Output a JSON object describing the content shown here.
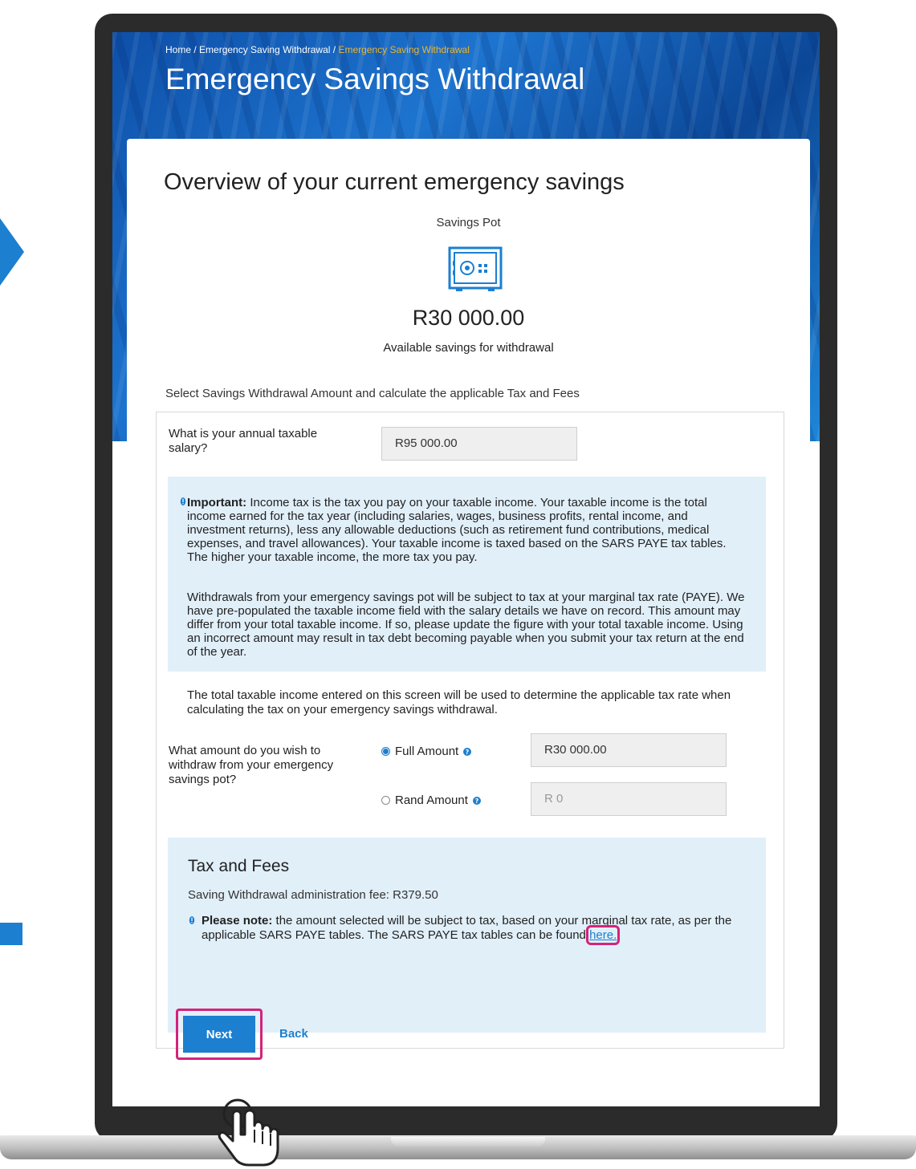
{
  "breadcrumb": {
    "home": "Home",
    "sep1": " / ",
    "section": "Emergency Saving Withdrawal",
    "sep2": " / ",
    "current": "Emergency Saving Withdrawal"
  },
  "page_title": "Emergency Savings Withdrawal",
  "overview": {
    "title": "Overview of your current emergency savings",
    "pot_label": "Savings Pot",
    "pot_icon": "safe-icon",
    "amount": "R30 000.00",
    "amount_caption": "Available savings for withdrawal",
    "select_caption": "Select Savings Withdrawal Amount and calculate the applicable Tax and Fees"
  },
  "salary": {
    "label": "What is your annual taxable salary?",
    "value": "R95 000.00"
  },
  "important": {
    "lead": "Important:",
    "para1": " Income tax is the tax you pay on your taxable income. Your taxable income is the total income earned for the tax year (including salaries, wages, business profits, rental income, and investment returns), less any allowable deductions (such as retirement fund contributions, medical expenses, and travel allowances). Your taxable income is taxed based on the SARS PAYE tax tables. The higher your taxable income, the more tax you pay.",
    "para2": "Withdrawals from your emergency savings pot will be subject to tax at your marginal tax rate (PAYE). We have pre-populated the taxable income field with the salary details we have on record. This amount may differ from your total taxable income. If so, please update the figure with your total taxable income. Using an incorrect amount may result in tax debt becoming payable when you submit your tax return at the end of the year."
  },
  "note": "The total taxable income entered on this screen will be used to determine the applicable tax rate when calculating the tax on your emergency savings withdrawal.",
  "withdraw": {
    "label": "What amount do you wish to withdraw from your emergency savings pot?",
    "full_label": "Full Amount",
    "full_value": "R30 000.00",
    "full_selected": true,
    "rand_label": "Rand Amount",
    "rand_placeholder": "R 0",
    "rand_selected": false
  },
  "tax_fees": {
    "title": "Tax and Fees",
    "fee": "Saving Withdrawal administration fee: R379.50",
    "note_lead": "Please note:",
    "note_text": " the amount selected will be subject to tax, based on your marginal tax rate, as per the applicable SARS PAYE tables. The SARS PAYE tax tables can be found ",
    "link": "here."
  },
  "actions": {
    "next": "Next",
    "back": "Back"
  },
  "colors": {
    "accent": "#1c7fd0",
    "highlight": "#d4237a",
    "breadcrumb_current": "#f0b429",
    "panel": "#e1eff9"
  }
}
